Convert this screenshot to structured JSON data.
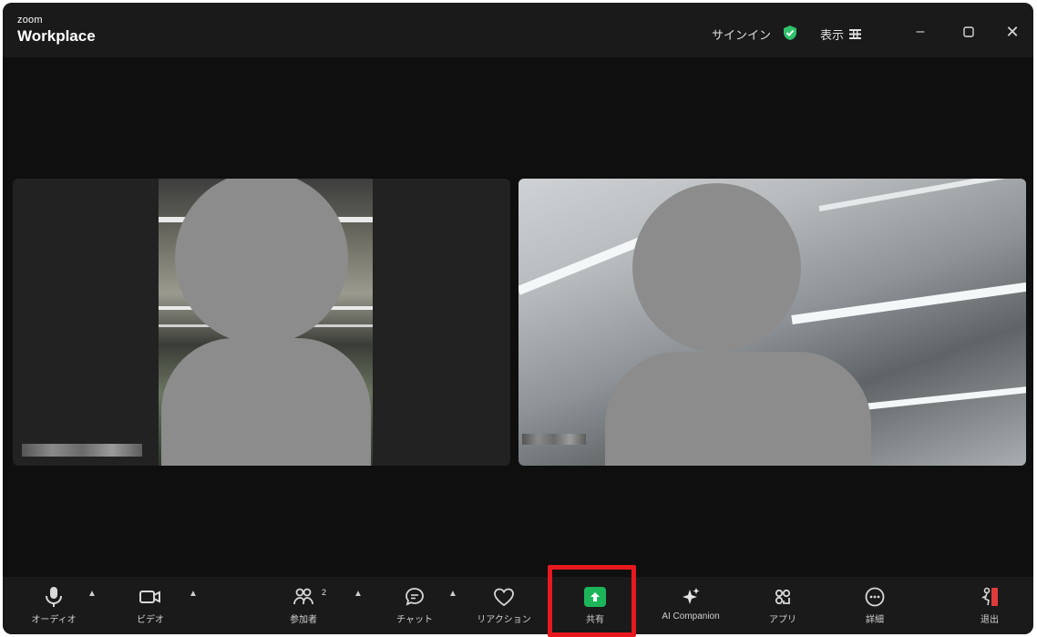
{
  "app": {
    "logo_small": "zoom",
    "logo_big": "Workplace"
  },
  "titlebar": {
    "signin": "サインイン",
    "view": "表示",
    "colors": {
      "shield": "#2ec26b"
    }
  },
  "toolbar": {
    "audio": "オーディオ",
    "video": "ビデオ",
    "participants": "参加者",
    "participants_count": "2",
    "chat": "チャット",
    "reaction": "リアクション",
    "share": "共有",
    "ai_companion": "AI Companion",
    "apps": "アプリ",
    "more": "詳細",
    "leave": "退出",
    "colors": {
      "share": "#1db55a",
      "leave": "#e03b3b",
      "highlight": "#e8181f"
    }
  }
}
